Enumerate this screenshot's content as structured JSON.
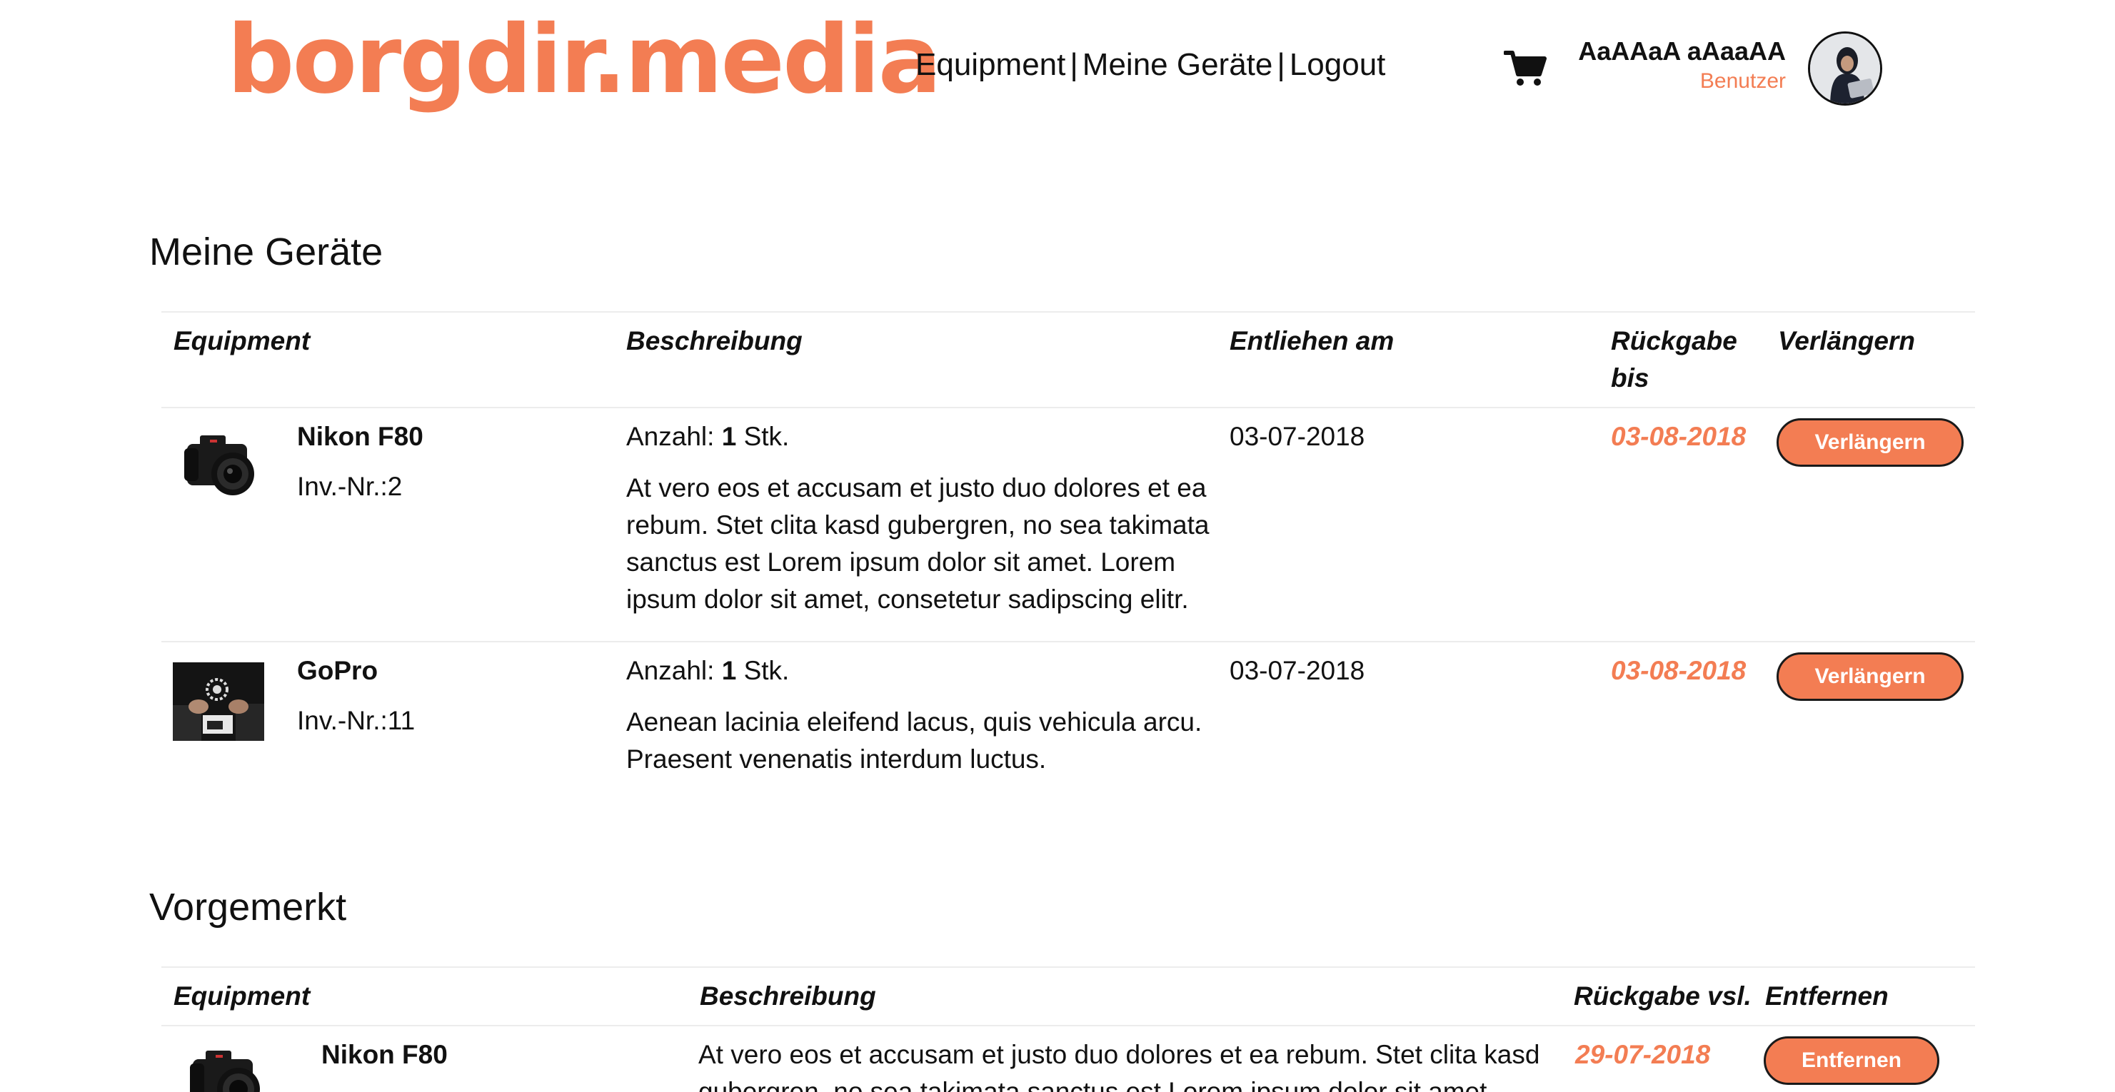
{
  "header": {
    "logo": "borgdir.media",
    "nav": {
      "equipment": "Equipment",
      "meine_geraete": "Meine Geräte",
      "logout": "Logout",
      "separator": "|"
    },
    "cart_icon": "shopping-cart-icon",
    "user": {
      "name": "AaAAaA aAaaAA",
      "role": "Benutzer"
    }
  },
  "meine_geraete": {
    "title": "Meine Geräte",
    "columns": {
      "equipment": "Equipment",
      "beschreibung": "Beschreibung",
      "entliehen": "Entliehen am",
      "rueckgabe_line1": "Rückgabe",
      "rueckgabe_line2": "bis",
      "verlaengern": "Verlängern"
    },
    "rows": [
      {
        "name": "Nikon F80",
        "inv": "Inv.-Nr.:2",
        "anzahl_label": "Anzahl:",
        "anzahl_value": "1",
        "anzahl_unit": "Stk.",
        "desc_lines": [
          "At vero eos et accusam et justo duo dolores et ea",
          "rebum. Stet clita kasd gubergren, no sea takimata",
          "sanctus est Lorem ipsum dolor sit amet. Lorem",
          "ipsum dolor sit amet, consetetur sadipscing elitr."
        ],
        "entliehen": "03-07-2018",
        "rueckgabe": "03-08-2018",
        "button": "Verlängern"
      },
      {
        "name": "GoPro",
        "inv": "Inv.-Nr.:11",
        "anzahl_label": "Anzahl:",
        "anzahl_value": "1",
        "anzahl_unit": "Stk.",
        "desc_lines": [
          "Aenean lacinia eleifend lacus, quis vehicula arcu.",
          "Praesent venenatis interdum luctus."
        ],
        "entliehen": "03-07-2018",
        "rueckgabe": "03-08-2018",
        "button": "Verlängern"
      }
    ]
  },
  "vorgemerkt": {
    "title": "Vorgemerkt",
    "columns": {
      "equipment": "Equipment",
      "beschreibung": "Beschreibung",
      "rueckgabe": "Rückgabe vsl.",
      "entfernen": "Entfernen"
    },
    "rows": [
      {
        "name": "Nikon F80",
        "desc_lines": [
          "At vero eos et accusam et justo duo dolores et ea rebum. Stet clita kasd",
          "gubergren, no sea takimata sanctus est Lorem ipsum dolor sit amet."
        ],
        "rueckgabe": "29-07-2018",
        "button": "Entfernen"
      }
    ]
  },
  "colors": {
    "accent": "#f37d53",
    "text": "#111111",
    "divider": "#ececec"
  }
}
